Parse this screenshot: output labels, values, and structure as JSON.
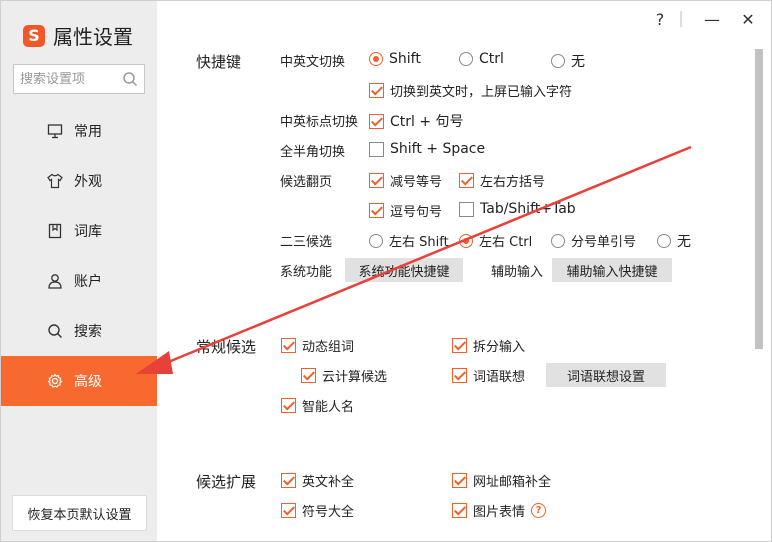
{
  "window": {
    "help_label": "?",
    "minimize_label": "—",
    "close_label": "✕"
  },
  "sidebar": {
    "logo_letter": "S",
    "title": "属性设置",
    "search_placeholder": "搜索设置项",
    "items": [
      {
        "label": "常用",
        "icon": "monitor-icon"
      },
      {
        "label": "外观",
        "icon": "shirt-icon"
      },
      {
        "label": "词库",
        "icon": "book-icon"
      },
      {
        "label": "账户",
        "icon": "user-icon"
      },
      {
        "label": "搜索",
        "icon": "search-icon"
      },
      {
        "label": "高级",
        "icon": "gear-icon",
        "active": true
      }
    ],
    "restore_label": "恢复本页默认设置"
  },
  "hotkeys": {
    "title": "快捷键",
    "cn_en_switch": {
      "label": "中英文切换",
      "options": [
        "Shift",
        "Ctrl",
        "无"
      ],
      "selected": "Shift",
      "sub_option": "切换到英文时，上屏已输入字符",
      "sub_checked": true
    },
    "punct_switch": {
      "label": "中英标点切换",
      "option": "Ctrl + 句号",
      "checked": true
    },
    "fullhalf_switch": {
      "label": "全半角切换",
      "option": "Shift + Space",
      "checked": false
    },
    "page_turn": {
      "label": "候选翻页",
      "options": [
        {
          "label": "减号等号",
          "checked": true
        },
        {
          "label": "左右方括号",
          "checked": true
        },
        {
          "label": "逗号句号",
          "checked": true
        },
        {
          "label": "Tab/Shift+Tab",
          "checked": false
        }
      ]
    },
    "second_third": {
      "label": "二三候选",
      "options": [
        "左右 Shift",
        "左右 Ctrl",
        "分号单引号",
        "无"
      ],
      "selected": "左右 Ctrl"
    },
    "system_func": {
      "label": "系统功能",
      "button": "系统功能快捷键"
    },
    "aux_input": {
      "label": "辅助输入",
      "button": "辅助输入快捷键"
    }
  },
  "general_candidates": {
    "title": "常规候选",
    "dynamic_words": "动态组词",
    "split_input": "拆分输入",
    "cloud_candidates": "云计算候选",
    "word_association": "词语联想",
    "association_button": "词语联想设置",
    "smart_names": "智能人名"
  },
  "candidate_extension": {
    "title": "候选扩展",
    "english_complete": "英文补全",
    "url_email_complete": "网址邮箱补全",
    "symbols": "符号大全",
    "image_emoji": "图片表情",
    "help_mark": "?"
  },
  "colors": {
    "accent": "#f7692f",
    "sidebar_bg": "#ededed",
    "annotation_arrow": "#e8413a"
  }
}
